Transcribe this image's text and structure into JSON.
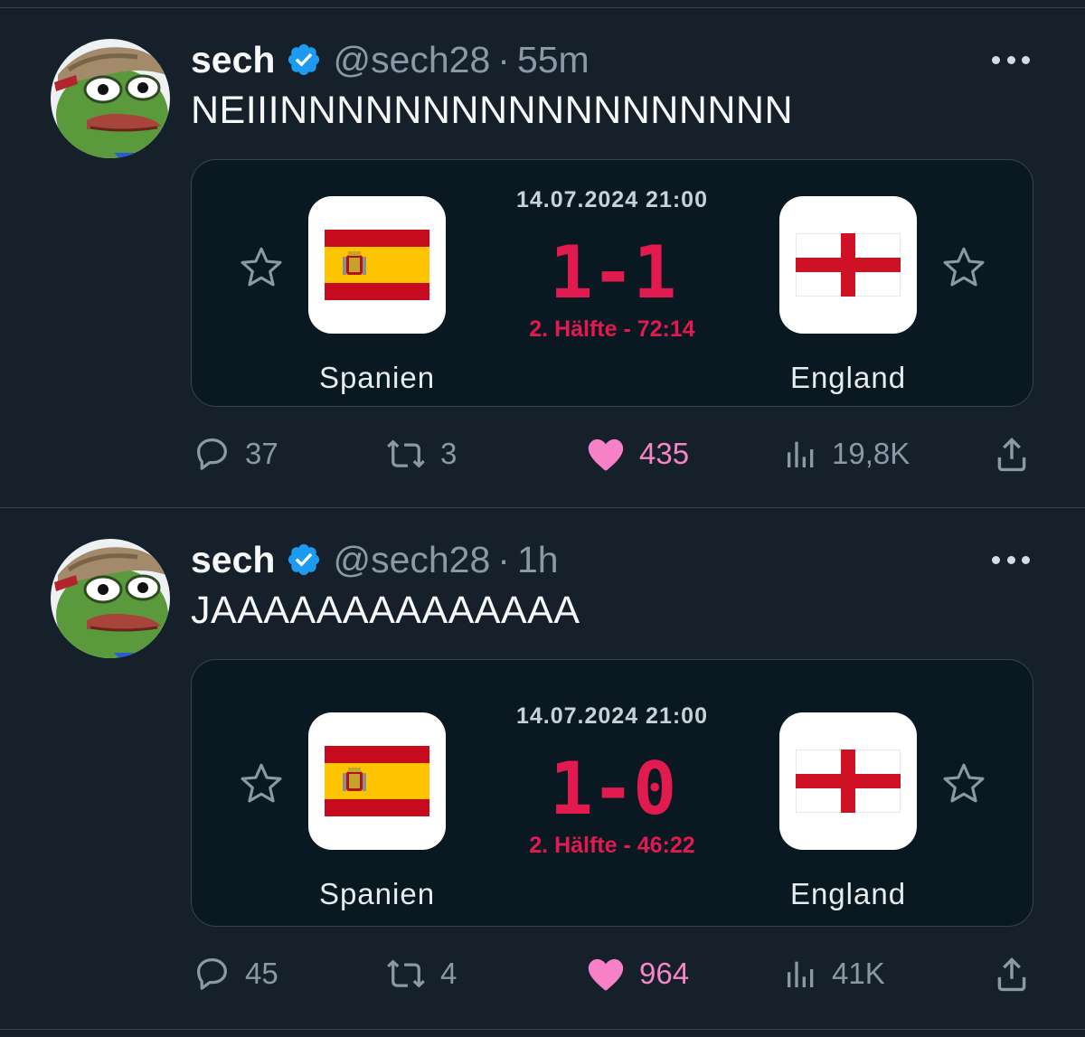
{
  "tweets": [
    {
      "author": {
        "name": "sech",
        "handle": "@sech28",
        "verified": true
      },
      "time": "55m",
      "text": "NEIIINNNNNNNNNNNNNNNNNN",
      "match": {
        "datetime": "14.07.2024 21:00",
        "score": "1-1",
        "status": "2. Hälfte - 72:14",
        "home_team": "Spanien",
        "away_team": "England"
      },
      "stats": {
        "replies": "37",
        "retweets": "3",
        "likes": "435",
        "views": "19,8K"
      }
    },
    {
      "author": {
        "name": "sech",
        "handle": "@sech28",
        "verified": true
      },
      "time": "1h",
      "text": "JAAAAAAAAAAAAAA",
      "match": {
        "datetime": "14.07.2024 21:00",
        "score": "1-0",
        "status": "2. Hälfte - 46:22",
        "home_team": "Spanien",
        "away_team": "England"
      },
      "stats": {
        "replies": "45",
        "retweets": "4",
        "likes": "964",
        "views": "41K"
      }
    }
  ],
  "colors": {
    "background": "#15202b",
    "card_background": "#0a1822",
    "verified_blue": "#1d9bf0",
    "score_red": "#e11a4f",
    "like_pink": "#f91880"
  },
  "icons": [
    "more-icon",
    "verified-icon",
    "favorite-star-icon",
    "reply-icon",
    "retweet-icon",
    "like-heart-icon",
    "views-icon",
    "share-icon"
  ]
}
